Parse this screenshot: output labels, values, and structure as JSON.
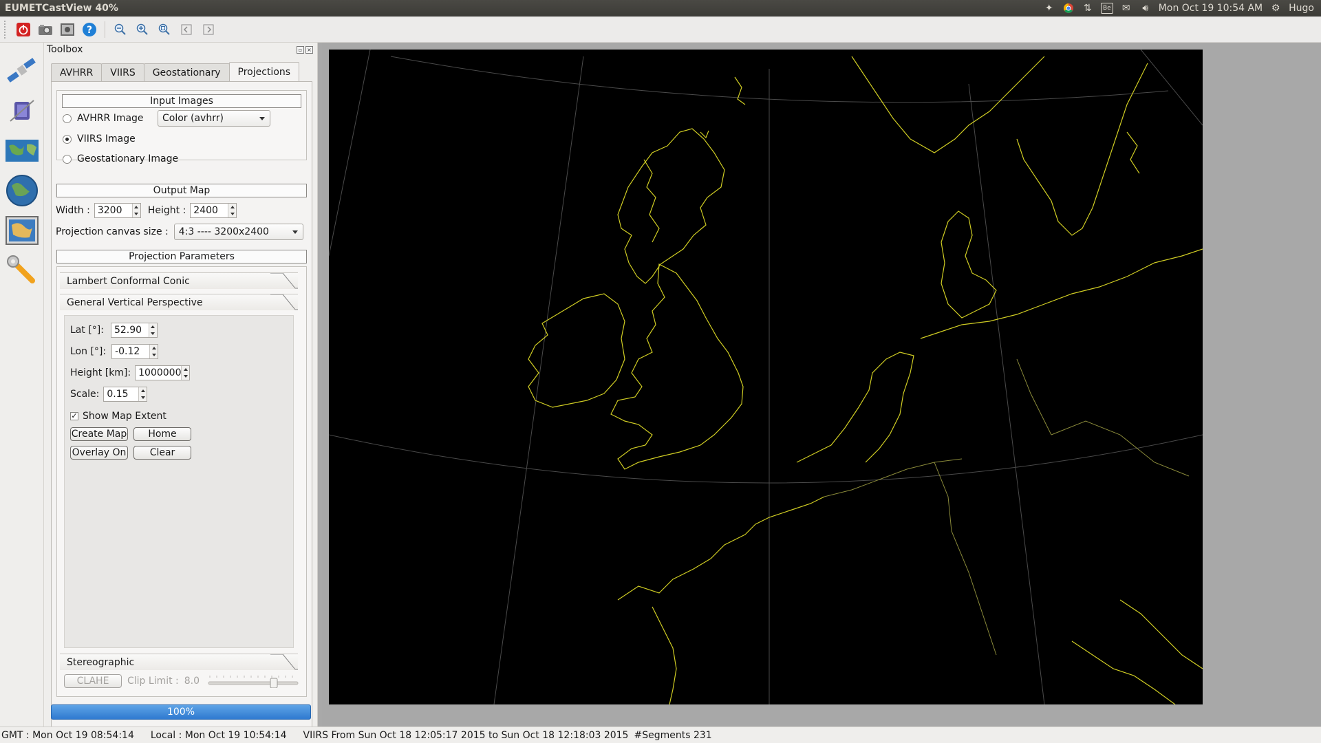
{
  "window": {
    "title": "EUMETCastView 40%"
  },
  "system_tray": {
    "clock": "Mon Oct 19 10:54 AM",
    "user": "Hugo",
    "icons": [
      "dropbox-icon",
      "chrome-icon",
      "network-icon",
      "be-icon",
      "mail-icon",
      "volume-icon",
      "settings-gear-icon"
    ],
    "be_label": "Be"
  },
  "toolbar": {
    "buttons": [
      "power-icon",
      "camera-icon",
      "screenshot-icon",
      "help-icon",
      "zoom-out-icon",
      "zoom-in-icon",
      "zoom-fit-icon",
      "prev-icon",
      "next-icon"
    ]
  },
  "left_nav": [
    "satellite-icon",
    "satellite-3d-icon",
    "world-map-icon",
    "globe-icon",
    "projection-map-icon",
    "tools-icon"
  ],
  "toolbox": {
    "title": "Toolbox",
    "tabs": [
      {
        "label": "AVHRR",
        "active": false
      },
      {
        "label": "VIIRS",
        "active": false
      },
      {
        "label": "Geostationary",
        "active": false
      },
      {
        "label": "Projections",
        "active": true
      }
    ],
    "input_images": {
      "label": "Input Images",
      "avhrr": "AVHRR Image",
      "viirs": "VIIRS Image",
      "geo": "Geostationary Image",
      "selected": "viirs",
      "color_combo": "Color  (avhrr)"
    },
    "output_map": {
      "label": "Output Map",
      "width_label": "Width :",
      "width_value": "3200",
      "height_label": "Height :",
      "height_value": "2400",
      "canvas_label": "Projection canvas size :",
      "canvas_value": "4:3  ----  3200x2400"
    },
    "projection_params": {
      "label": "Projection Parameters",
      "lcc": "Lambert Conformal Conic",
      "gvp": "General Vertical Perspective",
      "lat_label": "Lat [°]:",
      "lat_value": "52.90",
      "lon_label": "Lon [°]:",
      "lon_value": "-0.12",
      "height_label": "Height [km]:",
      "height_value": "1000000",
      "scale_label": "Scale:",
      "scale_value": "0.15",
      "show_extent": "Show Map Extent",
      "show_extent_checked": true,
      "create_map": "Create Map",
      "home": "Home",
      "overlay_on": "Overlay On",
      "clear": "Clear",
      "stereographic": "Stereographic"
    },
    "clahe": {
      "button": "CLAHE",
      "clip_label": "Clip Limit :",
      "clip_value": "8.0",
      "slider_fraction": 0.75
    },
    "progress": {
      "text": "100%",
      "fraction": 1.0
    }
  },
  "status_bar": {
    "gmt": "GMT : Mon Oct 19 08:54:14",
    "local": "Local : Mon Oct 19 10:54:14",
    "viirs": "VIIRS From Sun Oct 18 12:05:17 2015 to Sun Oct 18 12:18:03 2015",
    "segments": "#Segments 231"
  },
  "colors": {
    "coastline": "#e3e02a",
    "graticule": "#5a5a5a",
    "progress": "#3a86d8",
    "map_bg": "#000000"
  }
}
